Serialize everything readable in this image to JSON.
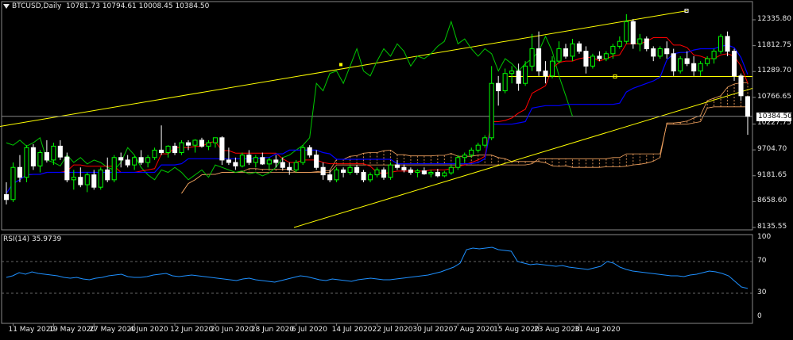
{
  "header": {
    "symbol_label": "BTCUSD,Daily",
    "ohlc_text": "10781.73 10794.61 10008.45 10384.50"
  },
  "rsi_header": {
    "label": "RSI(14) 35.9739"
  },
  "current_price_label": "10384.50",
  "colors": {
    "background": "#000000",
    "grid": "#444444",
    "bull_candle": "#00ff00",
    "bear_candle": "#ffffff",
    "candle_body_up": "#000000",
    "tenkan": "#ff0000",
    "kijun": "#0000ff",
    "chikou": "#00c800",
    "cloud": "#f4a460",
    "trendline": "#ffff00",
    "rsi_line": "#1e90ff"
  },
  "chart_data": [
    {
      "type": "candlestick",
      "title": "BTCUSD,Daily",
      "ylim": [
        8135.55,
        12520
      ],
      "y_ticks": [
        "12335.80",
        "11812.75",
        "11289.70",
        "10766.65",
        "10227.75",
        "9704.70",
        "9181.65",
        "8658.60",
        "8135.55"
      ],
      "x_ticks": [
        "11 May 2020",
        "19 May 2020",
        "27 May 2020",
        "4 Jun 2020",
        "12 Jun 2020",
        "20 Jun 2020",
        "28 Jun 2020",
        "6 Jul 2020",
        "14 Jul 2020",
        "22 Jul 2020",
        "30 Jul 2020",
        "7 Aug 2020",
        "15 Aug 2020",
        "23 Aug 2020",
        "31 Aug 2020"
      ],
      "indicators": [
        "Ichimoku Kinko Hyo",
        "Trend channel"
      ],
      "last_close": 10384.5,
      "candles": [
        [
          8800,
          9050,
          8600,
          8700
        ],
        [
          8700,
          9450,
          8650,
          9350
        ],
        [
          9350,
          9600,
          9050,
          9150
        ],
        [
          9150,
          9800,
          9050,
          9750
        ],
        [
          9750,
          9820,
          9300,
          9380
        ],
        [
          9380,
          9700,
          9250,
          9650
        ],
        [
          9650,
          9900,
          9450,
          9500
        ],
        [
          9500,
          9850,
          9400,
          9780
        ],
        [
          9780,
          9900,
          9500,
          9560
        ],
        [
          9560,
          9650,
          9050,
          9100
        ],
        [
          9100,
          9300,
          8900,
          9150
        ],
        [
          9150,
          9350,
          8950,
          9000
        ],
        [
          9000,
          9250,
          8850,
          9200
        ],
        [
          9200,
          9300,
          8900,
          8950
        ],
        [
          8950,
          9350,
          8900,
          9300
        ],
        [
          9300,
          9550,
          9050,
          9100
        ],
        [
          9100,
          9600,
          9050,
          9550
        ],
        [
          9550,
          9650,
          9350,
          9500
        ],
        [
          9500,
          9600,
          9350,
          9400
        ],
        [
          9400,
          9580,
          9300,
          9550
        ],
        [
          9550,
          9700,
          9400,
          9450
        ],
        [
          9450,
          9600,
          9350,
          9550
        ],
        [
          9550,
          9750,
          9500,
          9700
        ],
        [
          9700,
          10200,
          9600,
          9650
        ],
        [
          9650,
          9800,
          9550,
          9780
        ],
        [
          9780,
          9850,
          9600,
          9650
        ],
        [
          9650,
          9900,
          9600,
          9850
        ],
        [
          9850,
          9900,
          9700,
          9800
        ],
        [
          9800,
          9920,
          9650,
          9900
        ],
        [
          9900,
          9950,
          9750,
          9780
        ],
        [
          9780,
          9900,
          9700,
          9850
        ],
        [
          9850,
          9950,
          9750,
          9950
        ],
        [
          9950,
          9980,
          9400,
          9500
        ],
        [
          9500,
          9750,
          9400,
          9450
        ],
        [
          9450,
          9550,
          9300,
          9380
        ],
        [
          9380,
          9650,
          9350,
          9600
        ],
        [
          9600,
          9700,
          9400,
          9450
        ],
        [
          9450,
          9600,
          9350,
          9550
        ],
        [
          9550,
          9650,
          9400,
          9420
        ],
        [
          9420,
          9550,
          9300,
          9500
        ],
        [
          9500,
          9600,
          9350,
          9450
        ],
        [
          9450,
          9550,
          9300,
          9350
        ],
        [
          9350,
          9450,
          9200,
          9300
        ],
        [
          9300,
          9500,
          9250,
          9450
        ],
        [
          9450,
          9800,
          9400,
          9750
        ],
        [
          9750,
          9800,
          9550,
          9600
        ],
        [
          9600,
          9700,
          9300,
          9350
        ],
        [
          9350,
          9450,
          9100,
          9200
        ],
        [
          9200,
          9300,
          9050,
          9100
        ],
        [
          9100,
          9350,
          9050,
          9300
        ],
        [
          9300,
          9350,
          9150,
          9250
        ],
        [
          9250,
          9400,
          9200,
          9350
        ],
        [
          9350,
          9400,
          9200,
          9250
        ],
        [
          9250,
          9300,
          9050,
          9100
        ],
        [
          9100,
          9250,
          9050,
          9200
        ],
        [
          9200,
          9350,
          9150,
          9300
        ],
        [
          9300,
          9350,
          9100,
          9150
        ],
        [
          9150,
          9450,
          9100,
          9400
        ],
        [
          9400,
          9500,
          9300,
          9350
        ],
        [
          9350,
          9400,
          9250,
          9300
        ],
        [
          9300,
          9350,
          9200,
          9250
        ],
        [
          9250,
          9320,
          9150,
          9280
        ],
        [
          9280,
          9350,
          9200,
          9220
        ],
        [
          9220,
          9300,
          9150,
          9250
        ],
        [
          9250,
          9320,
          9150,
          9180
        ],
        [
          9180,
          9280,
          9150,
          9240
        ],
        [
          9240,
          9400,
          9200,
          9350
        ],
        [
          9350,
          9600,
          9300,
          9550
        ],
        [
          9550,
          9650,
          9450,
          9600
        ],
        [
          9600,
          9750,
          9550,
          9700
        ],
        [
          9700,
          9850,
          9650,
          9800
        ],
        [
          9800,
          10000,
          9750,
          9950
        ],
        [
          9950,
          11400,
          9900,
          11050
        ],
        [
          11050,
          11200,
          10600,
          10900
        ],
        [
          10900,
          11350,
          10850,
          11250
        ],
        [
          11250,
          11400,
          11050,
          11300
        ],
        [
          11300,
          11450,
          10900,
          11050
        ],
        [
          11050,
          11500,
          11000,
          11400
        ],
        [
          11400,
          12050,
          11300,
          11750
        ],
        [
          11750,
          12100,
          11200,
          11300
        ],
        [
          11300,
          11500,
          11050,
          11200
        ],
        [
          11200,
          11600,
          11150,
          11500
        ],
        [
          11500,
          11900,
          11450,
          11750
        ],
        [
          11750,
          11850,
          11550,
          11600
        ],
        [
          11600,
          11950,
          11500,
          11850
        ],
        [
          11850,
          11900,
          11650,
          11700
        ],
        [
          11700,
          11800,
          11250,
          11400
        ],
        [
          11400,
          11650,
          11350,
          11600
        ],
        [
          11600,
          11700,
          11500,
          11550
        ],
        [
          11550,
          11700,
          11500,
          11650
        ],
        [
          11650,
          11850,
          11550,
          11800
        ],
        [
          11800,
          12000,
          11750,
          11900
        ],
        [
          11900,
          12450,
          11850,
          12300
        ],
        [
          12300,
          12350,
          11750,
          11850
        ],
        [
          11850,
          12050,
          11700,
          11950
        ],
        [
          11950,
          12000,
          11700,
          11750
        ],
        [
          11750,
          11800,
          11500,
          11600
        ],
        [
          11600,
          11800,
          11550,
          11750
        ],
        [
          11750,
          11900,
          11550,
          11650
        ],
        [
          11650,
          11750,
          11200,
          11300
        ],
        [
          11300,
          11600,
          11250,
          11550
        ],
        [
          11550,
          11700,
          11400,
          11450
        ],
        [
          11450,
          11600,
          11200,
          11300
        ],
        [
          11300,
          11500,
          11200,
          11450
        ],
        [
          11450,
          11600,
          11400,
          11550
        ],
        [
          11550,
          11750,
          11450,
          11700
        ],
        [
          11700,
          12050,
          11650,
          12000
        ],
        [
          12000,
          12100,
          11600,
          11700
        ],
        [
          11700,
          11750,
          11100,
          11200
        ],
        [
          11200,
          11250,
          10700,
          10800
        ],
        [
          10781.73,
          10794.61,
          10008.45,
          10384.5
        ]
      ]
    },
    {
      "type": "line",
      "title": "RSI(14) 35.9739",
      "ylim": [
        0,
        100
      ],
      "y_ticks": [
        "100",
        "70",
        "30",
        "0"
      ],
      "series": [
        {
          "name": "RSI(14)",
          "values": [
            50,
            52,
            56,
            54,
            57,
            55,
            54,
            53,
            52,
            50,
            49,
            50,
            48,
            47,
            49,
            50,
            52,
            53,
            54,
            51,
            50,
            50,
            51,
            53,
            54,
            55,
            52,
            51,
            52,
            53,
            52,
            51,
            50,
            49,
            48,
            47,
            46,
            48,
            49,
            47,
            46,
            45,
            44,
            46,
            48,
            50,
            52,
            51,
            49,
            47,
            46,
            48,
            47,
            46,
            45,
            47,
            48,
            49,
            48,
            47,
            47,
            48,
            49,
            50,
            51,
            52,
            53,
            55,
            57,
            60,
            63,
            68,
            85,
            87,
            86,
            87,
            88,
            85,
            84,
            83,
            70,
            68,
            66,
            67,
            66,
            65,
            64,
            65,
            63,
            62,
            61,
            60,
            62,
            64,
            70,
            68,
            63,
            60,
            58,
            57,
            56,
            55,
            54,
            53,
            52,
            52,
            51,
            53,
            54,
            56,
            58,
            57,
            55,
            52,
            45,
            38,
            35.97
          ]
        }
      ]
    }
  ]
}
